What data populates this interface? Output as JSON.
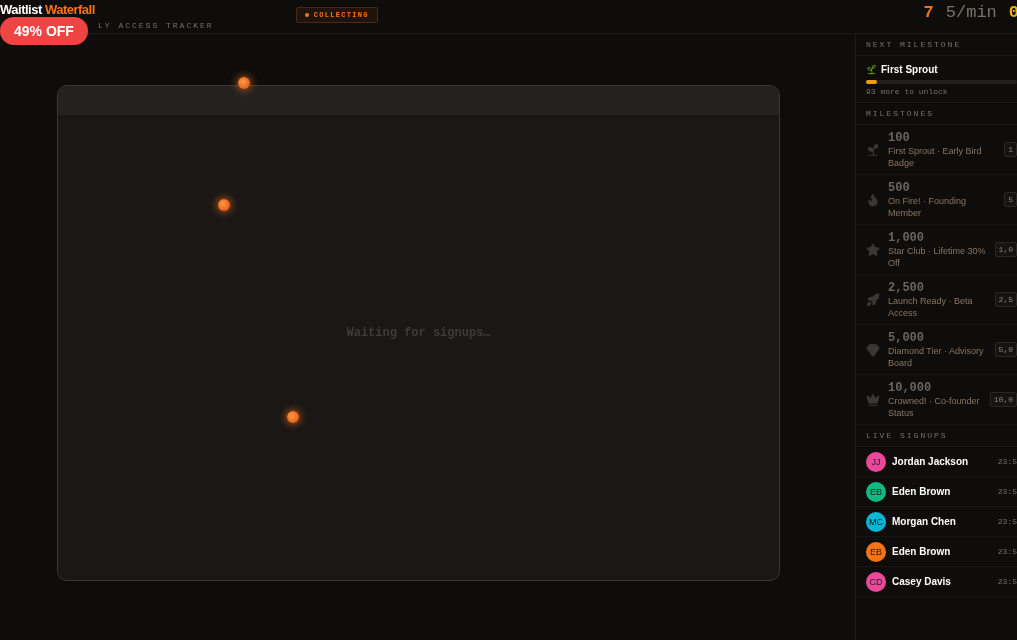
{
  "header": {
    "title_main": "Waitlist",
    "title_accent": "Waterfall",
    "subtitle": "LY ACCESS TRACKER",
    "status": "COLLECTING",
    "promo": "49% OFF"
  },
  "stats": [
    {
      "value": "7",
      "kind": "count"
    },
    {
      "value": "5/min",
      "kind": "rate"
    },
    {
      "value": "0",
      "kind": "next"
    }
  ],
  "canvas": {
    "message": "Waiting for signups…"
  },
  "next_milestone": {
    "heading": "NEXT MILESTONE",
    "name": "First Sprout",
    "level": 0.07,
    "note": "93 more to unlock"
  },
  "milestones": {
    "heading": "MILESTONES",
    "items": [
      {
        "target": "100",
        "reward": "First Sprout · Early Bird Badge",
        "tag": "1"
      },
      {
        "target": "500",
        "reward": "On Fire! · Founding Member",
        "tag": "5"
      },
      {
        "target": "1,000",
        "reward": "Star Club · Lifetime 30% Off",
        "tag": "1,0"
      },
      {
        "target": "2,500",
        "reward": "Launch Ready · Beta Access",
        "tag": "2,5"
      },
      {
        "target": "5,000",
        "reward": "Diamond Tier · Advisory Board",
        "tag": "5,0"
      },
      {
        "target": "10,000",
        "reward": "Crowned! · Co-founder Status",
        "tag": "10,0"
      }
    ]
  },
  "signups": {
    "heading": "LIVE SIGNUPS",
    "items": [
      {
        "initials": "JJ",
        "name": "Jordan Jackson",
        "color": "#ec4899",
        "time": "23:5"
      },
      {
        "initials": "EB",
        "name": "Eden Brown",
        "color": "#10b981",
        "time": "23:5"
      },
      {
        "initials": "MC",
        "name": "Morgan Chen",
        "color": "#06b6d4",
        "time": "23:5"
      },
      {
        "initials": "EB",
        "name": "Eden Brown",
        "color": "#f97316",
        "time": "23:5"
      },
      {
        "initials": "CD",
        "name": "Casey Davis",
        "color": "#ec4899",
        "time": "23:5"
      }
    ]
  }
}
